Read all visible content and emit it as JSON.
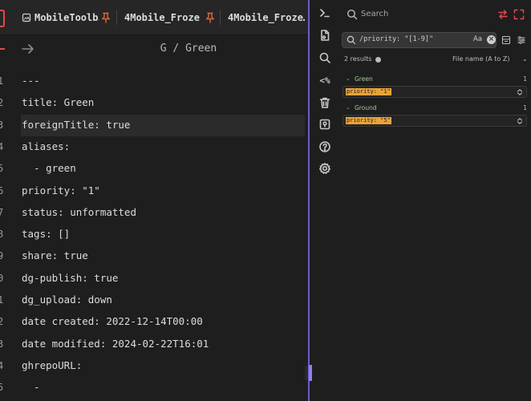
{
  "tabs": [
    {
      "label": "MobileToolb…",
      "icon": "document-icon",
      "pinned": true
    },
    {
      "label": "4Mobile_Froze…",
      "icon": "pin-icon",
      "pinned": true
    },
    {
      "label": "4Mobile_Froze…",
      "icon": "pin-icon",
      "pinned": false
    }
  ],
  "editor": {
    "breadcrumb": "G / Green",
    "lines": [
      {
        "num": "1",
        "text": "---"
      },
      {
        "num": "2",
        "text": "title: Green"
      },
      {
        "num": "3",
        "text": "foreignTitle: true"
      },
      {
        "num": "4",
        "text": "aliases:"
      },
      {
        "num": "5",
        "text": "  - green"
      },
      {
        "num": "6",
        "text": "priority: \"1\""
      },
      {
        "num": "7",
        "text": "status: unformatted"
      },
      {
        "num": "8",
        "text": "tags: []"
      },
      {
        "num": "9",
        "text": "share: true"
      },
      {
        "num": "0",
        "text": "dg-publish: true"
      },
      {
        "num": "1",
        "text": "dg_upload: down"
      },
      {
        "num": "2",
        "text": "date created: 2022-12-14T00:00"
      },
      {
        "num": "3",
        "text": "date modified: 2024-02-22T16:01"
      },
      {
        "num": "4",
        "text": "ghrepoURL:"
      },
      {
        "num": "5",
        "text": "  -"
      }
    ]
  },
  "ribbon": [
    {
      "name": "terminal-icon"
    },
    {
      "name": "new-file-icon"
    },
    {
      "name": "search-icon"
    },
    {
      "name": "percent-code-icon",
      "text": "<%"
    },
    {
      "name": "trash-icon"
    },
    {
      "name": "map-pin-icon"
    },
    {
      "name": "help-icon"
    },
    {
      "name": "settings-icon"
    }
  ],
  "search": {
    "title": "Search",
    "query": "/priority: \"[1-9]\"",
    "match_case_label": "Aa",
    "results_count": "2 results",
    "sort_label": "File name (A to Z)",
    "groups": [
      {
        "name": "Green",
        "count": "1",
        "match": "priority: \"1\""
      },
      {
        "name": "Ground",
        "count": "1",
        "match": "priority: \"5\""
      }
    ]
  },
  "colors": {
    "accent": "#8d7ff0",
    "pin": "#e0693b",
    "highlight": "#e8a33a",
    "danger": "#e5484d"
  }
}
